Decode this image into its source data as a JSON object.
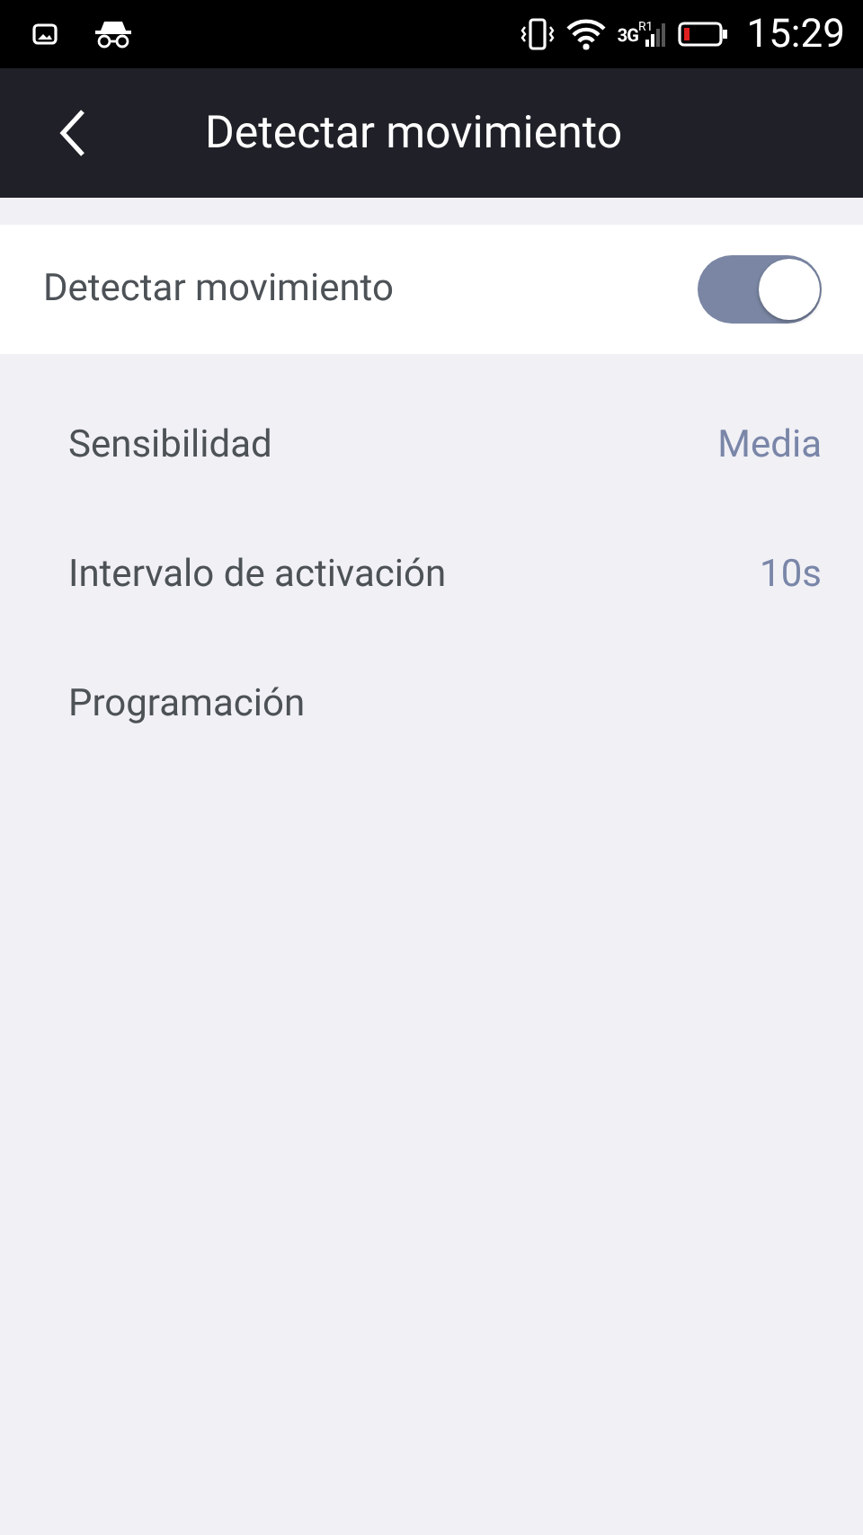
{
  "status_bar": {
    "network": "3G",
    "roaming": "R1",
    "time": "15:29"
  },
  "app_bar": {
    "title": "Detectar movimiento"
  },
  "main_toggle": {
    "label": "Detectar movimiento",
    "on": true
  },
  "settings": [
    {
      "label": "Sensibilidad",
      "value": "Media"
    },
    {
      "label": "Intervalo de activación",
      "value": "10s"
    },
    {
      "label": "Programación"
    }
  ]
}
